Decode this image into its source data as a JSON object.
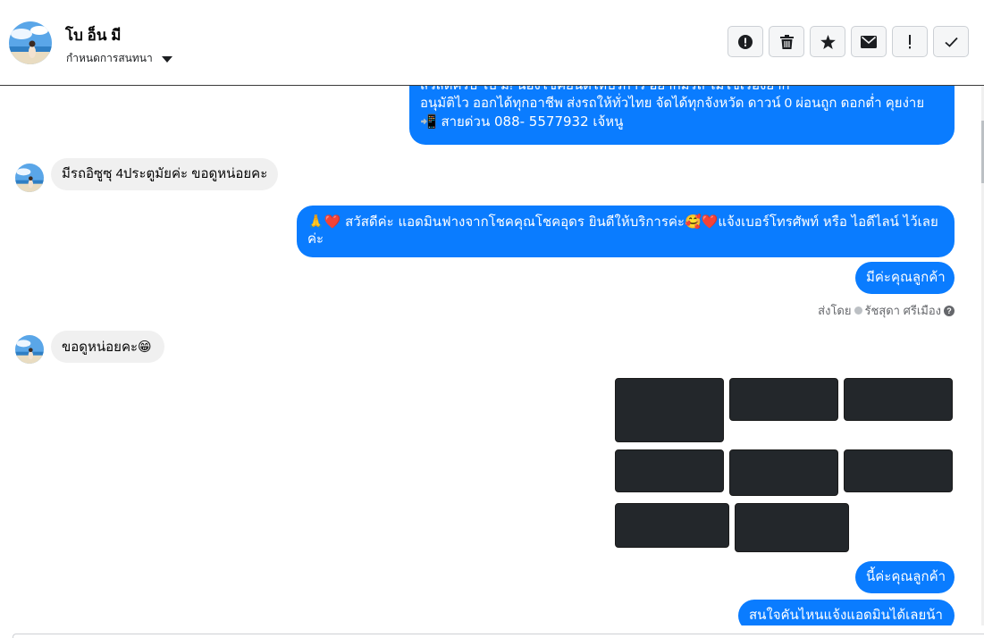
{
  "header": {
    "contact_name": "โบ อ็น มี",
    "label_menu": "กำหนดการสนทนา",
    "actions": [
      {
        "icon": "exclamation-circle-icon",
        "name": "report-button"
      },
      {
        "icon": "trash-icon",
        "name": "delete-button"
      },
      {
        "icon": "star-icon",
        "name": "star-button"
      },
      {
        "icon": "envelope-icon",
        "name": "mark-unread-button"
      },
      {
        "icon": "exclamation-icon",
        "name": "important-button"
      },
      {
        "icon": "check-icon",
        "name": "done-button"
      }
    ]
  },
  "messages": {
    "m1": {
      "line1": "สวัสดีครับ โบ มี! น้องโชคยินดีให้บริการ อยากมีรถ ไม่ใช่เรื่องยาก",
      "line2": "อนุมัติไว ออกได้ทุกอาชีพ ส่งรถให้ทั่วไทย จัดได้ทุกจังหวัด ดาวน์ 0  ผ่อนถูก ดอกต่ำ คุยง่าย",
      "line3": "📲 สายด่วน 088- 5577932 เจ้หนู"
    },
    "m2": "มีรถอิซูซุ 4ประตูมัยค่ะ ขอดูหน่อยคะ",
    "m3": {
      "line1": "🙏❤️ สวัสดีค่ะ แอดมินฟางจากโชคคุณโชคอุดร ยินดีให้บริการค่ะ🥰❤️แจ้งเบอร์โทรศัพท์ หรือ ไอดีไลน์  ไว้เลย",
      "line2": "ค่ะ"
    },
    "m4": "มีค่ะคุณลูกค้า",
    "sent_by_label": "ส่งโดย",
    "sent_by_name": "รัชสุดา ศรีเมือง",
    "m5": "ขอดูหน่อยคะ😁",
    "m6": "นี้ค่ะคุณลูกค้า",
    "m7": "สนใจคันไหนแจ้งแอดมินได้เลยน้า"
  },
  "colors": {
    "outgoing_bubble": "#0a7cff",
    "incoming_bubble": "#f0f0f0"
  }
}
